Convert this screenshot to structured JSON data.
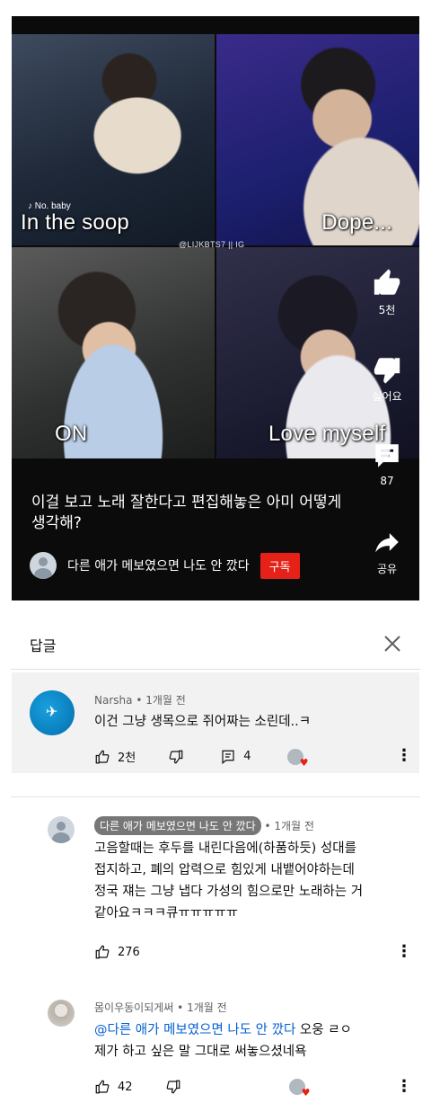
{
  "video": {
    "panels": [
      {
        "label": "In the soop"
      },
      {
        "label": "Dope..."
      },
      {
        "label": "ON"
      },
      {
        "label": "Love myself"
      }
    ],
    "lyric_overlay": "♪ No. baby",
    "watermark": "@LIJKBTS7 || IG",
    "caption": "이걸 보고 노래 잘한다고 편집해놓은 아미 어떻게 생각해?",
    "channel_name": "다른 애가 메보였으면 나도 안 깠다",
    "subscribe_label": "구독",
    "actions": {
      "like_count": "5천",
      "dislike_label": "싫어요",
      "comment_count": "87",
      "share_label": "공유"
    }
  },
  "panel": {
    "title": "답글"
  },
  "comments": [
    {
      "author": "Narsha",
      "time": "1개월 전",
      "text": "이건 그냥 생목으로 쥐어짜는 소린데..ㅋ",
      "likes": "2천",
      "replies": "4"
    },
    {
      "author": "다른 애가 메보였으면 나도 안 깠다",
      "time": "1개월 전",
      "text_lines": [
        "고음할때는 후두를 내린다음에(하품하듯) 성대를",
        "접지하고, 폐의 압력으로 힘있게 내뱉어야하는데",
        "정국 쟤는 그냥 냅다 가성의 힘으로만 노래하는 거",
        "같아요ㅋㅋㅋ큐ㅠㅠㅠㅠㅠ"
      ],
      "likes": "276"
    },
    {
      "author": "몸이우동이되게써",
      "time": "1개월 전",
      "mention": "@다른 애가 메보였으면 나도 안 깠다",
      "text_tail": "오웅 ㄹㅇ",
      "text_line2": "제가 하고 싶은 말 그대로 써놓으셨네욕",
      "likes": "42"
    }
  ],
  "colors": {
    "subscribe": "#e62117",
    "mention": "#065fd4",
    "highlight_bg": "#f2f2f2"
  }
}
